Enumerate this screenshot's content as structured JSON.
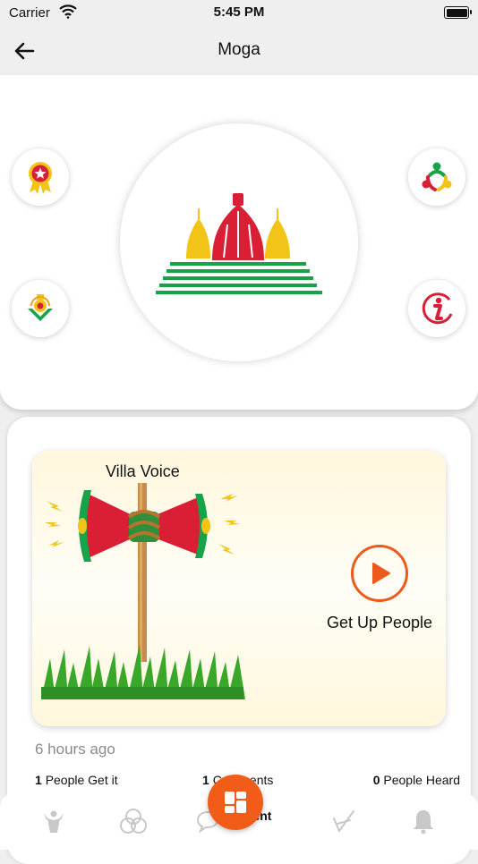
{
  "status_bar": {
    "carrier": "Carrier",
    "time": "5:45 PM"
  },
  "header": {
    "title": "Moga"
  },
  "post": {
    "label": "Villa Voice",
    "cta": "Get Up People",
    "time_ago": "6 hours ago",
    "stats": {
      "get_it_count": "1",
      "get_it_label": "People Get it",
      "comments_count": "1",
      "comments_label": "Comments",
      "heard_count": "0",
      "heard_label": "People Heard"
    }
  },
  "tabbar": {
    "partial_label": "ment"
  },
  "colors": {
    "accent": "#f25c19",
    "temple_red": "#d91e36",
    "temple_yellow": "#f2c418",
    "temple_green": "#16a34a"
  },
  "icons": {
    "left_top": "award-ribbon-icon",
    "left_bottom": "emblem-icon",
    "right_top": "community-icon",
    "right_bottom": "info-icon",
    "center": "temple-logo"
  }
}
